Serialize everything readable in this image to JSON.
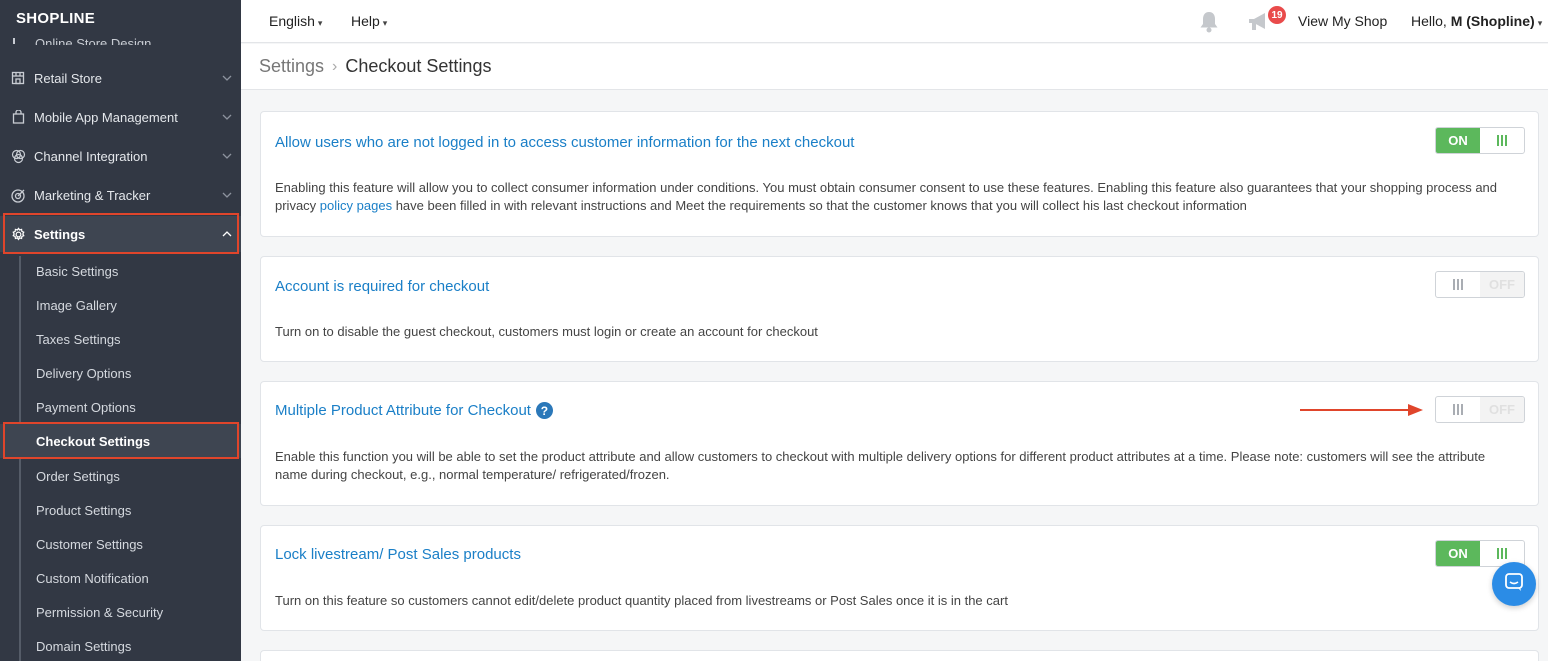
{
  "brand": {
    "logo_bold": "SHOPLINE",
    "logo_rest": ""
  },
  "sidebar": {
    "partial_label": "Online Store Design",
    "items": [
      {
        "label": "Retail Store",
        "icon": "store-icon"
      },
      {
        "label": "Mobile App Management",
        "icon": "bag-icon"
      },
      {
        "label": "Channel Integration",
        "icon": "channels-icon"
      },
      {
        "label": "Marketing & Tracker",
        "icon": "target-icon"
      },
      {
        "label": "Settings",
        "icon": "gear-icon"
      }
    ],
    "sub_items": [
      "Basic Settings",
      "Image Gallery",
      "Taxes Settings",
      "Delivery Options",
      "Payment Options",
      "Checkout Settings",
      "Order Settings",
      "Product Settings",
      "Customer Settings",
      "Custom Notification",
      "Permission & Security",
      "Domain Settings"
    ]
  },
  "topbar": {
    "language": "English",
    "help": "Help",
    "notification_count": "19",
    "view_shop": "View My Shop",
    "greeting": "Hello,",
    "user": "M (Shopline)"
  },
  "breadcrumb": {
    "root": "Settings",
    "current": "Checkout Settings"
  },
  "cards": [
    {
      "title": "Allow users who are not logged in to access customer information for the next checkout",
      "desc_before": "Enabling this feature will allow you to collect consumer information under conditions. You must obtain consumer consent to use these features. Enabling this feature also guarantees that your shopping process and privacy ",
      "desc_link": "policy pages",
      "desc_after": " have been filled in with relevant instructions and Meet the requirements so that the customer knows that you will collect his last checkout information",
      "toggle": "ON"
    },
    {
      "title": "Account is required for checkout",
      "desc": "Turn on to disable the guest checkout, customers must login or create an account for checkout",
      "toggle": "OFF"
    },
    {
      "title": "Multiple Product Attribute for Checkout",
      "desc": "Enable this function you will be able to set the product attribute and allow customers to checkout with multiple delivery options for different product attributes at a time. Please note: customers will see the attribute name during checkout, e.g., normal temperature/ refrigerated/frozen.",
      "toggle": "OFF"
    },
    {
      "title": "Lock livestream/ Post Sales products",
      "desc": "Turn on this feature so customers cannot edit/delete product quantity placed from livestreams or Post Sales once it is in the cart",
      "toggle": "ON"
    }
  ],
  "colors": {
    "accent": "#e0452b",
    "link": "#1a7fc7",
    "toggle_on": "#5cb85c",
    "sidebar_bg": "#323844"
  }
}
